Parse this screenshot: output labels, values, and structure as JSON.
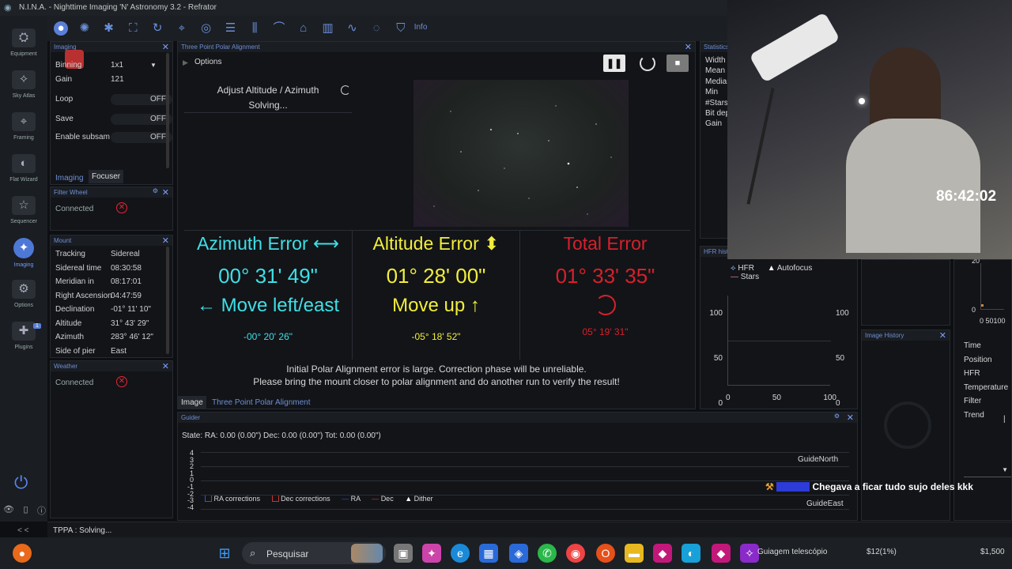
{
  "app": {
    "title": "N.I.N.A. - Nighttime Imaging 'N' Astronomy 3.2 - Refrator"
  },
  "nav": [
    {
      "label": "Equipment",
      "icon": "equipment-icon"
    },
    {
      "label": "Sky Atlas",
      "icon": "sky-atlas-icon"
    },
    {
      "label": "Framing",
      "icon": "framing-icon"
    },
    {
      "label": "Flat Wizard",
      "icon": "flat-wizard-icon"
    },
    {
      "label": "Sequencer",
      "icon": "sequencer-icon"
    },
    {
      "label": "Imaging",
      "icon": "imaging-icon"
    },
    {
      "label": "Options",
      "icon": "gear-icon"
    },
    {
      "label": "Plugins",
      "icon": "puzzle-icon",
      "badge": "1"
    }
  ],
  "nav_footer": {
    "collapse": "< <"
  },
  "toolbar": {
    "info_label": "Info"
  },
  "imaging_panel": {
    "title": "Imaging",
    "rows": [
      {
        "k": "Binning",
        "v": "1x1"
      },
      {
        "k": "Gain",
        "v": "121"
      },
      {
        "k": "Loop",
        "v": "OFF"
      },
      {
        "k": "Save",
        "v": "OFF"
      },
      {
        "k": "Enable subsam",
        "v": "OFF"
      }
    ],
    "tabs": [
      "Imaging",
      "Focuser"
    ]
  },
  "filter_wheel": {
    "title": "Filter Wheel",
    "status": "Connected"
  },
  "mount": {
    "title": "Mount",
    "rows": [
      {
        "k": "Tracking",
        "v": "Sidereal"
      },
      {
        "k": "Sidereal time",
        "v": "08:30:58"
      },
      {
        "k": "Meridian in",
        "v": "08:17:01"
      },
      {
        "k": "Right Ascension",
        "v": "04:47:59"
      },
      {
        "k": "Declination",
        "v": "-01° 11' 10\""
      },
      {
        "k": "Altitude",
        "v": "31° 43' 29\""
      },
      {
        "k": "Azimuth",
        "v": "283° 46' 12\""
      },
      {
        "k": "Side of pier",
        "v": "East"
      }
    ]
  },
  "weather": {
    "title": "Weather",
    "status": "Connected"
  },
  "tppa": {
    "title": "Three Point Polar Alignment",
    "options": "Options",
    "step": "Adjust Altitude / Azimuth",
    "step_status": "Solving...",
    "azimuth": {
      "label": "Azimuth Error ⟷",
      "value": "00° 31' 49\"",
      "hint": "← Move left/east",
      "sub": "-00° 20' 26\""
    },
    "altitude": {
      "label": "Altitude Error ⬍",
      "value": "01° 28' 00\"",
      "hint": "Move up ↑",
      "sub": "-05° 18' 52\""
    },
    "total": {
      "label": "Total Error",
      "value": "01° 33' 35\"",
      "sub": "05° 19' 31\""
    },
    "msg1": "Initial Polar Alignment error is large. Correction phase will be unreliable.",
    "msg2": "Please bring the mount closer to polar alignment and do another run to verify the result!",
    "tabs": [
      "Image",
      "Three Point Polar Alignment"
    ]
  },
  "statistics": {
    "title": "Statistics",
    "rows": [
      "Width",
      "Mean",
      "Median",
      "Min",
      "#Stars",
      "Bit depth",
      "Gain"
    ]
  },
  "hfr": {
    "title": "HFR history",
    "legend": [
      "HFR",
      "Autofocus",
      "Stars"
    ],
    "yticks": [
      "100",
      "50",
      "0"
    ],
    "xticks": [
      "0",
      "50",
      "100"
    ]
  },
  "image_history": {
    "title": "Image History"
  },
  "right_info": {
    "rows": [
      "Time",
      "Position",
      "HFR",
      "Temperature",
      "Filter",
      "Trend"
    ],
    "yticks": [
      "20",
      "0"
    ],
    "xticks": "0 50100"
  },
  "guider": {
    "title": "Guider",
    "state": "State:  RA: 0.00 (0.00\")  Dec: 0.00 (0.00\")  Tot: 0.00 (0.00\")",
    "yticks": [
      "4",
      "3",
      "2",
      "1",
      "0",
      "-1",
      "-2",
      "-3",
      "-4"
    ],
    "north": "GuideNorth",
    "east": "GuideEast",
    "legend": [
      "RA corrections",
      "Dec corrections",
      "RA",
      "Dec",
      "Dither"
    ]
  },
  "statusbar": {
    "text": "TPPA :   Solving..."
  },
  "overlay": {
    "timer": "86:42:02",
    "chat_user": "",
    "chat_msg": "Chegava a ficar tudo sujo deles kkk"
  },
  "taskbar": {
    "search": "Pesquisar",
    "item1": "Guiagem telescópio",
    "item2": "$12(1%)",
    "item3": "$1,500"
  },
  "colors": {
    "cyan": "#3ee0e6",
    "yellow": "#f2ee3c",
    "red": "#d8202a",
    "accent": "#5a7fd8"
  }
}
